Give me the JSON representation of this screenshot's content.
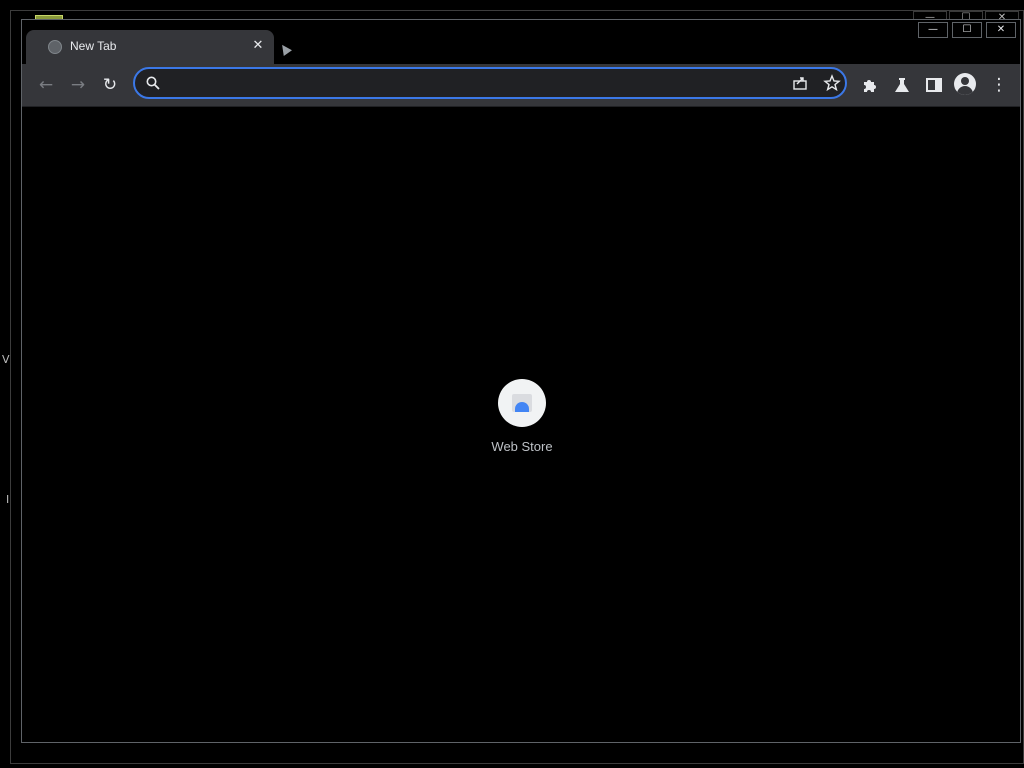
{
  "tab": {
    "title": "New Tab",
    "close_glyph": "✕"
  },
  "window_controls": {
    "minimize": "—",
    "maximize": "☐",
    "close": "✕"
  },
  "toolbar": {
    "back_glyph": "←",
    "forward_glyph": "→",
    "reload_glyph": "↻",
    "menu_glyph": "⋮"
  },
  "omnibox": {
    "value": "",
    "placeholder": ""
  },
  "shortcuts": [
    {
      "label": "Web Store",
      "icon": "webstore-icon"
    }
  ],
  "colors": {
    "accent": "#3b78e7",
    "toolbar": "#35363a",
    "tab": "#35363a",
    "page": "#000000"
  },
  "stray": [
    "V",
    "I"
  ]
}
